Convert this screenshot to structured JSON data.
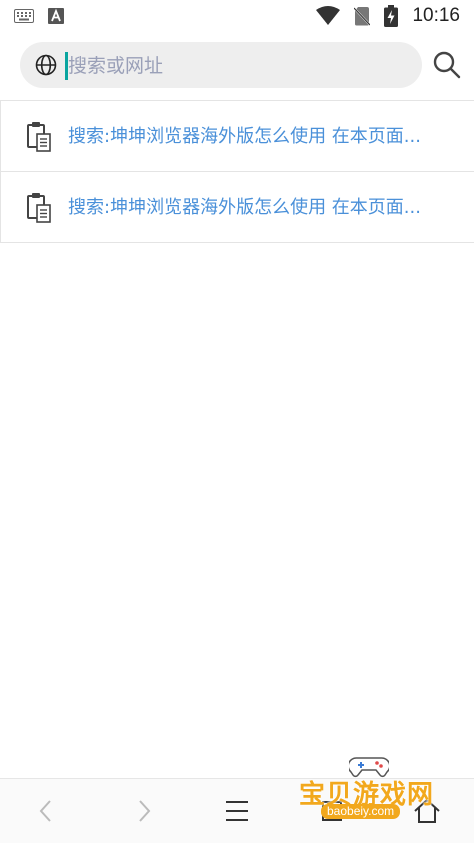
{
  "status_bar": {
    "time": "10:16",
    "icons": [
      "keyboard-icon",
      "a-badge-icon",
      "wifi-icon",
      "no-sim-icon",
      "battery-charging-icon"
    ]
  },
  "search": {
    "placeholder": "搜索或网址",
    "value": "",
    "left_icon": "globe-icon",
    "button_icon": "search-icon"
  },
  "suggestions": [
    {
      "icon": "clipboard-icon",
      "text": "搜索:坤坤浏览器海外版怎么使用 在本页面..."
    },
    {
      "icon": "clipboard-icon",
      "text": "搜索:坤坤浏览器海外版怎么使用 在本页面..."
    }
  ],
  "bottom_nav": {
    "items": [
      "back-icon",
      "forward-icon",
      "menu-icon",
      "tabs-icon",
      "home-icon"
    ]
  },
  "watermark": {
    "title": "宝贝游戏网",
    "url": "baobeiy.com"
  },
  "colors": {
    "accent": "#0aa5a0",
    "link": "#4a90d9",
    "pill": "#eeeeee",
    "watermark": "#f2a81d"
  }
}
